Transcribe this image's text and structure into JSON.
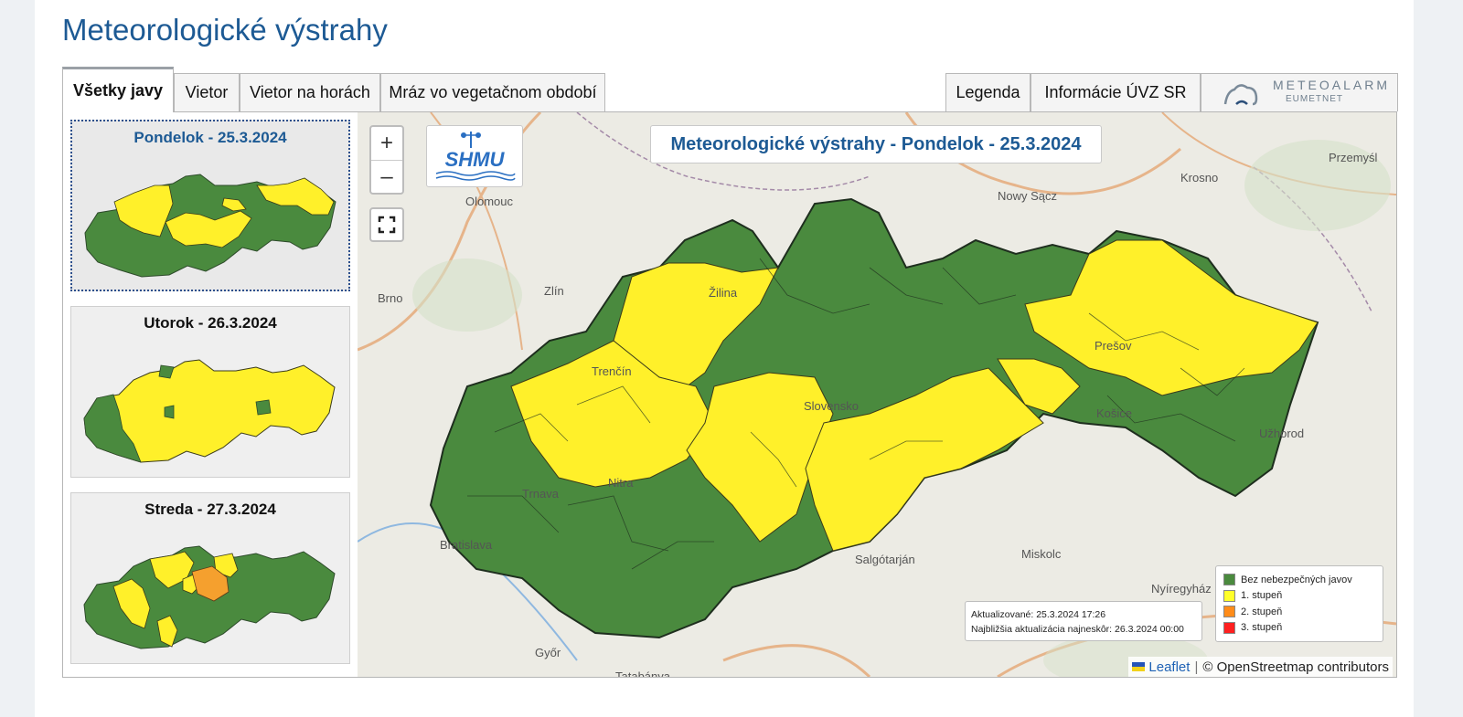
{
  "page_title": "Meteorologické výstrahy",
  "tabs": [
    "Všetky javy",
    "Vietor",
    "Vietor na horách",
    "Mráz vo vegetačnom období"
  ],
  "right_tabs": [
    "Legenda",
    "Informácie ÚVZ SR"
  ],
  "meteoalarm": {
    "line1": "METEOALARM",
    "line2": "EUMETNET"
  },
  "days": [
    {
      "label": "Pondelok - 25.3.2024",
      "selected": true
    },
    {
      "label": "Utorok - 26.3.2024",
      "selected": false
    },
    {
      "label": "Streda - 27.3.2024",
      "selected": false
    }
  ],
  "map": {
    "title": "Meteorologické výstrahy - Pondelok - 25.3.2024",
    "zoom_in": "+",
    "zoom_out": "–",
    "logo_text": "SHMU",
    "updated": "Aktualizované: 25.3.2024 17:26",
    "next_update": "Najbližšia aktualizácia najneskôr: 26.3.2024 00:00",
    "attribution_link": "Leaflet",
    "attribution_sep": "|",
    "attribution_text": "© OpenStreetmap contributors",
    "cities": [
      "Olomouc",
      "Nowy Sącz",
      "Krosno",
      "Przemyśl",
      "Brno",
      "Zlín",
      "Žilina",
      "Trenčín",
      "Prešov",
      "Slovensko",
      "Košice",
      "Užhorod",
      "Trnava",
      "Nitra",
      "Bratislava",
      "Salgótarján",
      "Miskolc",
      "Nyíregyház",
      "Győr",
      "Tatabánya"
    ]
  },
  "legend": {
    "items": [
      {
        "label": "Bez nebezpečných javov",
        "color": "#4a8a3e"
      },
      {
        "label": "1. stupeň",
        "color": "#ffff2a"
      },
      {
        "label": "2. stupeň",
        "color": "#ff8c1a"
      },
      {
        "label": "3. stupeň",
        "color": "#ff2020"
      }
    ]
  },
  "colors": {
    "green": "#4a8a3e",
    "yellow": "#fff02a",
    "orange": "#f5a02e",
    "accent": "#1d5a94"
  }
}
